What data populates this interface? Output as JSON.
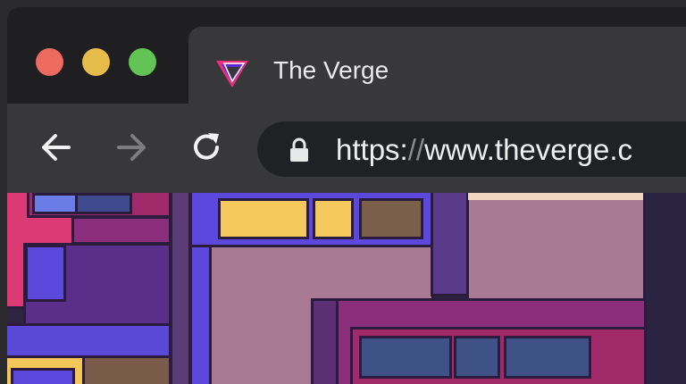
{
  "window": {
    "traffic_lights": {
      "close": {
        "color": "#ed6a5e"
      },
      "minimize": {
        "color": "#e6bd4b"
      },
      "zoom": {
        "color": "#61c454"
      }
    }
  },
  "tab": {
    "title": "The Verge",
    "logo_icon": "verge-logo-icon"
  },
  "toolbar": {
    "back_icon": "arrow-left-icon",
    "forward_icon": "arrow-right-icon",
    "reload_icon": "reload-icon"
  },
  "address_bar": {
    "lock_icon": "lock-icon",
    "url_scheme": "https:",
    "url_separator": "//",
    "url_rest": "www.theverge.c"
  },
  "colors": {
    "tab_bar": "#1f1f21",
    "active_tab": "#38383b",
    "url_field": "#202124",
    "text": "#eaeaea"
  }
}
